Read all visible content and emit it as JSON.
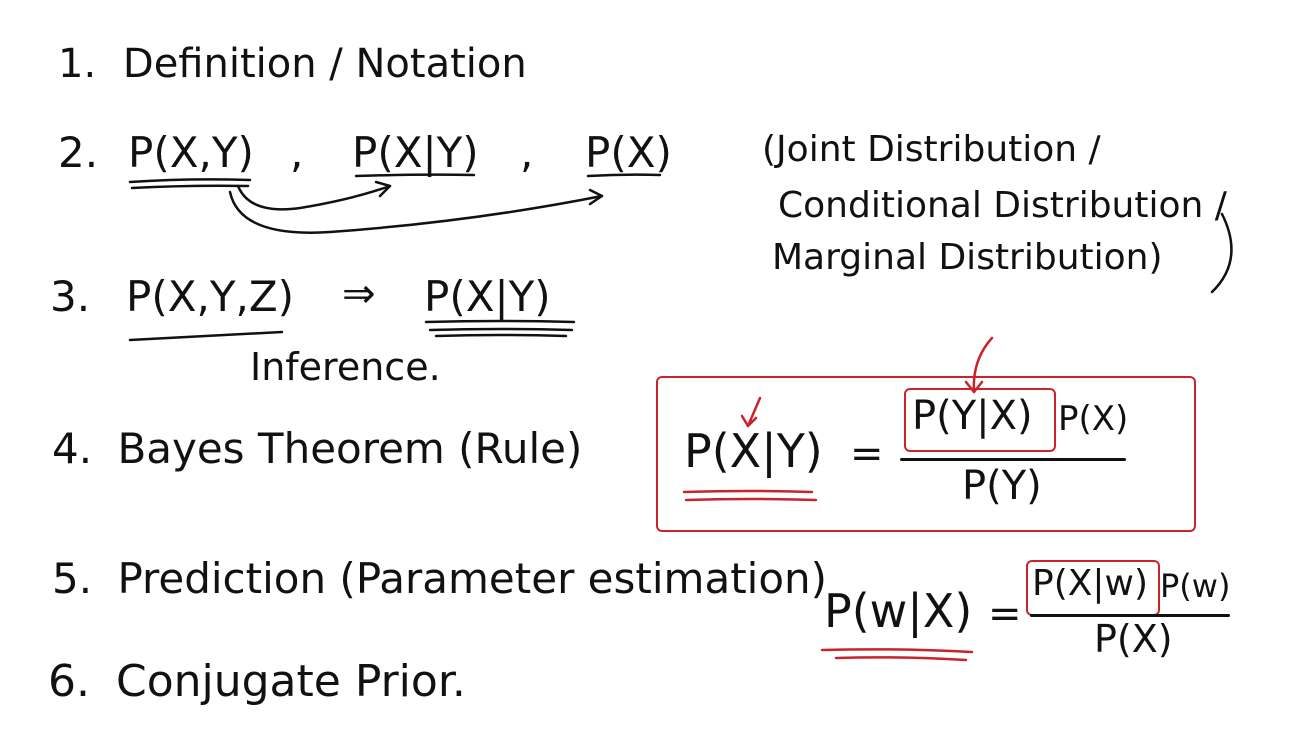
{
  "colors": {
    "ink": "#111111",
    "red_ink": "#c8242a",
    "background": "#ffffff"
  },
  "items": [
    {
      "num": "1.",
      "text": "Definition / Notation"
    },
    {
      "num": "2.",
      "terms": [
        "P(X,Y)",
        ",",
        "P(X|Y)",
        ",",
        "P(X)"
      ]
    },
    {
      "num": "3.",
      "text_left": "P(X,Y,Z)",
      "arrow": "⇒",
      "text_right": "P(X|Y)",
      "caption": "Inference."
    },
    {
      "num": "4.",
      "text": "Bayes Theorem (Rule)"
    },
    {
      "num": "5.",
      "text": "Prediction (Parameter estimation)"
    },
    {
      "num": "6.",
      "text": "Conjugate Prior."
    }
  ],
  "distribution_note": {
    "line1": "(Joint Distribution /",
    "line2": "Conditional Distribution /",
    "line3": "Marginal Distribution)"
  },
  "bayes_formula": {
    "lhs": "P(X|Y)",
    "equals": "=",
    "num_boxed": "P(Y|X)",
    "num_rest": "P(X)",
    "den": "P(Y)"
  },
  "prediction_formula": {
    "lhs": "P(w|X)",
    "equals": "=",
    "num_boxed": "P(X|w)",
    "num_rest": "P(w)",
    "den": "P(X)"
  }
}
